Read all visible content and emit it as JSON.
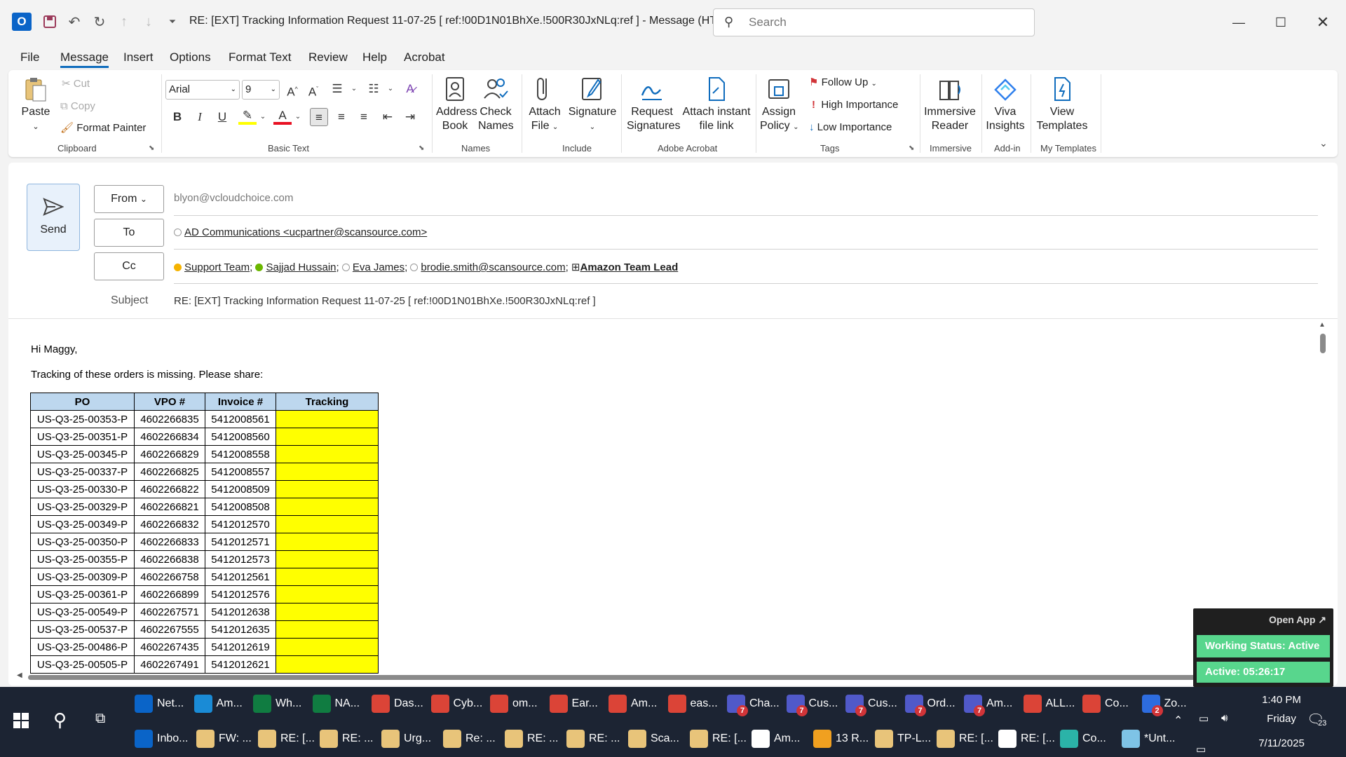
{
  "window": {
    "title": "RE: [EXT] Tracking Information Request  11-07-25    [ ref:!00D1N01BhXe.!500R30JxNLq:ref ]  -  Message (HT...",
    "search_placeholder": "Search"
  },
  "menu": [
    "File",
    "Message",
    "Insert",
    "Options",
    "Format Text",
    "Review",
    "Help",
    "Acrobat"
  ],
  "ribbon": {
    "clipboard": {
      "paste": "Paste",
      "cut": "Cut",
      "copy": "Copy",
      "format_painter": "Format Painter",
      "label": "Clipboard"
    },
    "basic_text": {
      "font": "Arial",
      "size": "9",
      "label": "Basic Text"
    },
    "names": {
      "address_book_1": "Address",
      "address_book_2": "Book",
      "check_names_1": "Check",
      "check_names_2": "Names",
      "label": "Names"
    },
    "include": {
      "attach_1": "Attach",
      "attach_2": "File",
      "signature": "Signature",
      "label": "Include"
    },
    "adobe": {
      "request_1": "Request",
      "request_2": "Signatures",
      "attach_link_1": "Attach instant",
      "attach_link_2": "file link",
      "label": "Adobe Acrobat"
    },
    "tags": {
      "assign_1": "Assign",
      "assign_2": "Policy",
      "follow_up": "Follow Up",
      "high": "High Importance",
      "low": "Low Importance",
      "label": "Tags"
    },
    "immersive": {
      "reader_1": "Immersive",
      "reader_2": "Reader",
      "label": "Immersive"
    },
    "addin": {
      "viva_1": "Viva",
      "viva_2": "Insights",
      "label": "Add-in"
    },
    "templates": {
      "view_1": "View",
      "view_2": "Templates",
      "label": "My Templates"
    }
  },
  "compose": {
    "send": "Send",
    "from_label": "From",
    "from_value": "blyon@vcloudchoice.com",
    "to_label": "To",
    "to_value": "AD Communications <ucpartner@scansource.com>",
    "cc_label": "Cc",
    "cc": [
      {
        "name": "Support Team",
        "sep": ";",
        "status_color": "#f5b301"
      },
      {
        "name": "Sajjad Hussain",
        "sep": ";",
        "status_color": "#6bb700"
      },
      {
        "name": "Eva James",
        "sep": ";",
        "status_color": "none"
      },
      {
        "name": "brodie.smith@scansource.com",
        "sep": ";",
        "status_color": "none"
      }
    ],
    "cc_group": "Amazon Team Lead",
    "subject_label": "Subject",
    "subject_value": "RE: [EXT] Tracking Information Request  11-07-25    [ ref:!00D1N01BhXe.!500R30JxNLq:ref ]"
  },
  "body": {
    "greeting": "Hi Maggy,",
    "intro": "Tracking of these orders is missing. Please share:",
    "columns": [
      "PO",
      "VPO #",
      "Invoice #",
      "Tracking"
    ],
    "rows": [
      [
        "US-Q3-25-00353-P",
        "4602266835",
        "5412008561",
        ""
      ],
      [
        "US-Q3-25-00351-P",
        "4602266834",
        "5412008560",
        ""
      ],
      [
        "US-Q3-25-00345-P",
        "4602266829",
        "5412008558",
        ""
      ],
      [
        "US-Q3-25-00337-P",
        "4602266825",
        "5412008557",
        ""
      ],
      [
        "US-Q3-25-00330-P",
        "4602266822",
        "5412008509",
        ""
      ],
      [
        "US-Q3-25-00329-P",
        "4602266821",
        "5412008508",
        ""
      ],
      [
        "US-Q3-25-00349-P",
        "4602266832",
        "5412012570",
        ""
      ],
      [
        "US-Q3-25-00350-P",
        "4602266833",
        "5412012571",
        ""
      ],
      [
        "US-Q3-25-00355-P",
        "4602266838",
        "5412012573",
        ""
      ],
      [
        "US-Q3-25-00309-P",
        "4602266758",
        "5412012561",
        ""
      ],
      [
        "US-Q3-25-00361-P",
        "4602266899",
        "5412012576",
        ""
      ],
      [
        "US-Q3-25-00549-P",
        "4602267571",
        "5412012638",
        ""
      ],
      [
        "US-Q3-25-00537-P",
        "4602267555",
        "5412012635",
        ""
      ],
      [
        "US-Q3-25-00486-P",
        "4602267435",
        "5412012619",
        ""
      ],
      [
        "US-Q3-25-00505-P",
        "4602267491",
        "5412012621",
        ""
      ]
    ],
    "tracking_fill_color": "#ffff00",
    "header_fill_color": "#bdd7ee"
  },
  "popup": {
    "open_app": "Open App ↗",
    "status": "Working Status: Active",
    "timer": "Active: 05:26:17"
  },
  "taskbar": {
    "row1": [
      {
        "label": "Net...",
        "icon": "outlook-icon",
        "color": "#0a64c8",
        "badge": ""
      },
      {
        "label": "Am...",
        "icon": "edge-icon",
        "color": "#1a8bd6",
        "badge": ""
      },
      {
        "label": "Wh...",
        "icon": "excel-icon",
        "color": "#107c41",
        "badge": ""
      },
      {
        "label": "NA...",
        "icon": "excel-icon",
        "color": "#107c41",
        "badge": ""
      },
      {
        "label": "Das...",
        "icon": "chrome-icon",
        "color": "#db4437",
        "badge": ""
      },
      {
        "label": "Cyb...",
        "icon": "chrome-icon",
        "color": "#db4437",
        "badge": ""
      },
      {
        "label": "om...",
        "icon": "chrome-icon",
        "color": "#db4437",
        "badge": ""
      },
      {
        "label": "Ear...",
        "icon": "chrome-icon",
        "color": "#db4437",
        "badge": ""
      },
      {
        "label": "Am...",
        "icon": "chrome-icon",
        "color": "#db4437",
        "badge": ""
      },
      {
        "label": "eas...",
        "icon": "chrome-icon",
        "color": "#db4437",
        "badge": ""
      },
      {
        "label": "Cha...",
        "icon": "teams-icon",
        "color": "#5059c9",
        "badge": "7"
      },
      {
        "label": "Cus...",
        "icon": "teams-icon",
        "color": "#5059c9",
        "badge": "7"
      },
      {
        "label": "Cus...",
        "icon": "teams-icon",
        "color": "#5059c9",
        "badge": "7"
      },
      {
        "label": "Ord...",
        "icon": "teams-icon",
        "color": "#5059c9",
        "badge": "7"
      },
      {
        "label": "Am...",
        "icon": "teams-icon",
        "color": "#5059c9",
        "badge": "7"
      },
      {
        "label": "ALL...",
        "icon": "chrome-icon",
        "color": "#db4437",
        "badge": ""
      },
      {
        "label": "Co...",
        "icon": "chrome-icon",
        "color": "#db4437",
        "badge": ""
      },
      {
        "label": "Zo...",
        "icon": "zoho-icon",
        "color": "#2d6cdf",
        "badge": "2"
      }
    ],
    "row2": [
      {
        "label": "Inbo...",
        "icon": "outlook-icon",
        "color": "#0a64c8"
      },
      {
        "label": "FW: ...",
        "icon": "mail-icon",
        "color": "#e8c47a"
      },
      {
        "label": "RE: [...",
        "icon": "mail-icon",
        "color": "#e8c47a"
      },
      {
        "label": "RE: ...",
        "icon": "mail-icon",
        "color": "#e8c47a"
      },
      {
        "label": "Urg...",
        "icon": "mail-icon",
        "color": "#e8c47a"
      },
      {
        "label": "Re: ...",
        "icon": "mail-icon",
        "color": "#e8c47a"
      },
      {
        "label": "RE: ...",
        "icon": "mail-icon",
        "color": "#e8c47a"
      },
      {
        "label": "RE: ...",
        "icon": "mail-icon",
        "color": "#e8c47a"
      },
      {
        "label": "Sca...",
        "icon": "mail-icon",
        "color": "#e8c47a"
      },
      {
        "label": "RE: [...",
        "icon": "mail-icon",
        "color": "#e8c47a"
      },
      {
        "label": "Am...",
        "icon": "mail-icon",
        "color": "#ffffff"
      },
      {
        "label": "13 R...",
        "icon": "bell-icon",
        "color": "#f0a020"
      },
      {
        "label": "TP-L...",
        "icon": "mail-icon",
        "color": "#e8c47a"
      },
      {
        "label": "RE: [...",
        "icon": "mail-icon",
        "color": "#e8c47a"
      },
      {
        "label": "RE: [...",
        "icon": "mail-icon",
        "color": "#ffffff"
      },
      {
        "label": "Co...",
        "icon": "app-icon",
        "color": "#2bb3a8"
      },
      {
        "label": "*Unt...",
        "icon": "notepad-icon",
        "color": "#7ec3e6"
      }
    ],
    "time": "1:40 PM",
    "day": "Friday",
    "date": "7/11/2025",
    "notifications": "23"
  }
}
